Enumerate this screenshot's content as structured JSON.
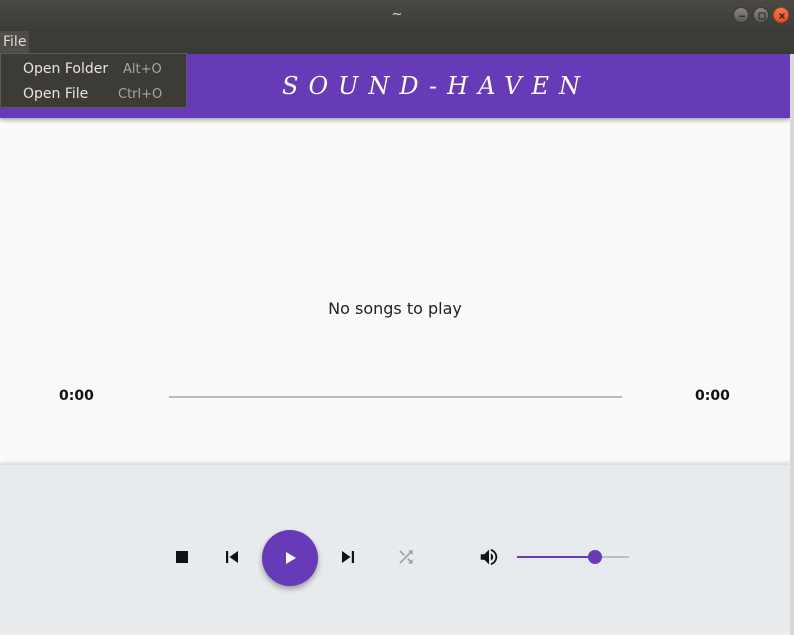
{
  "window": {
    "title": "~"
  },
  "menubar": {
    "file_label": "File"
  },
  "file_menu": {
    "items": [
      {
        "label": "Open Folder",
        "shortcut": "Alt+O"
      },
      {
        "label": "Open File",
        "shortcut": "Ctrl+O"
      }
    ]
  },
  "app": {
    "logo": "SOUND-HAVEN",
    "empty_message": "No songs to play",
    "time_elapsed": "0:00",
    "time_total": "0:00",
    "progress": 0,
    "volume": 0.7
  },
  "icons": {
    "stop": "stop-icon",
    "previous": "skip-previous-icon",
    "play": "play-icon",
    "next": "skip-next-icon",
    "shuffle": "shuffle-icon",
    "volume": "volume-icon"
  },
  "colors": {
    "accent": "#673ab7",
    "titlebar": "#3e3c38",
    "controls_bg": "#e8ebed"
  }
}
